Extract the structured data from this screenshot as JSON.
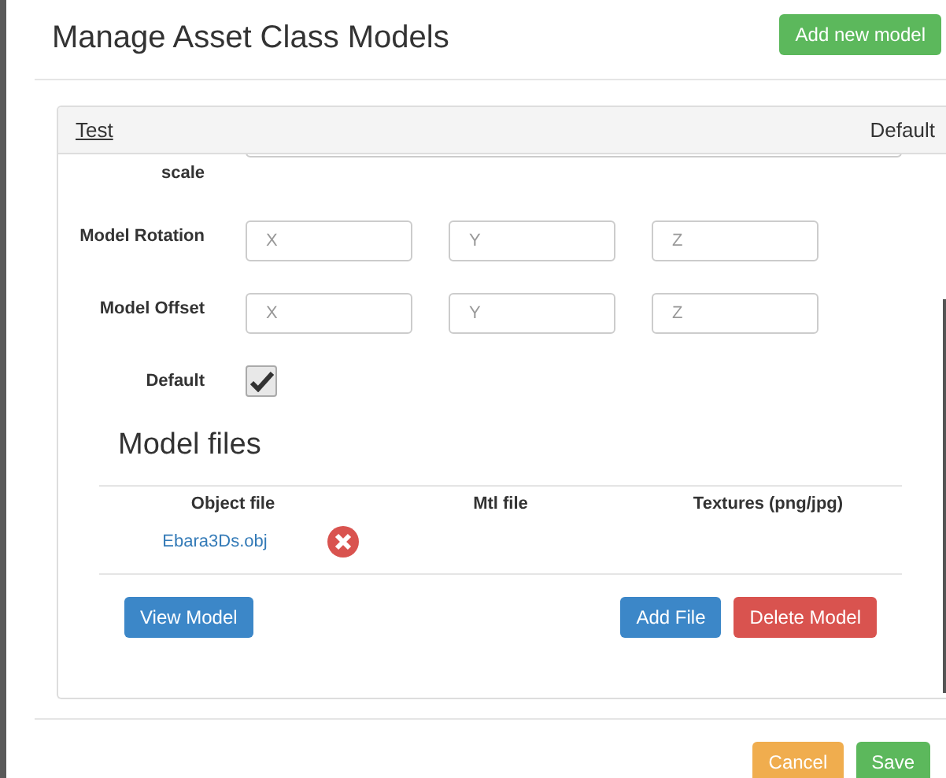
{
  "title": "Manage Asset Class Models",
  "add_button": "Add new model",
  "panel": {
    "name": "Test",
    "default_label": "Default",
    "fields": [
      {
        "kind": "wide",
        "label": "scale"
      },
      {
        "kind": "xyz",
        "label": "Model Rotation",
        "placeholders": [
          "X",
          "Y",
          "Z"
        ]
      },
      {
        "kind": "xyz",
        "label": "Model Offset",
        "placeholders": [
          "X",
          "Y",
          "Z"
        ]
      },
      {
        "kind": "checkbox",
        "label": "Default",
        "checked": true
      }
    ],
    "files_heading": "Model files",
    "columns": [
      "Object file",
      "Mtl file",
      "Textures (png/jpg)"
    ],
    "rows": [
      {
        "object_file": "Ebara3Ds.obj"
      }
    ],
    "buttons": [
      {
        "kind": "primary",
        "label": "View Model"
      },
      {
        "kind": "primary",
        "label": "Add File"
      },
      {
        "kind": "danger",
        "label": "Delete Model"
      }
    ]
  },
  "footer_buttons": [
    {
      "kind": "warning",
      "label": "Cancel"
    },
    {
      "kind": "success",
      "label": "Save"
    }
  ]
}
